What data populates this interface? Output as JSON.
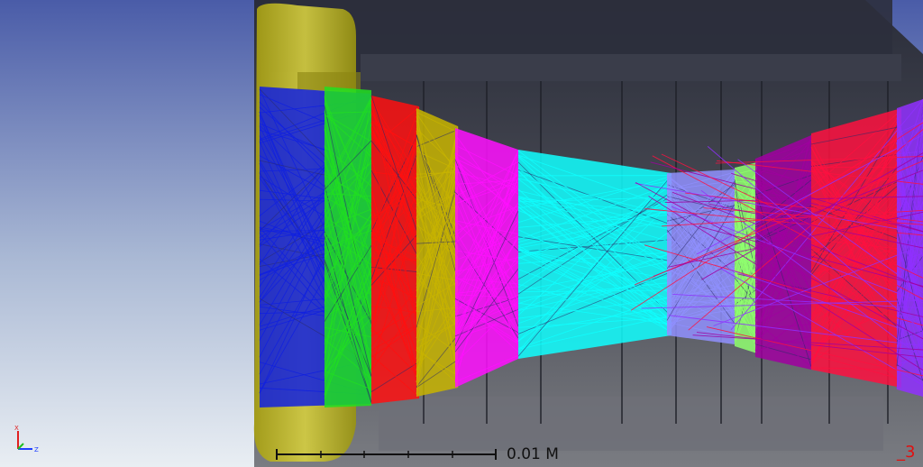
{
  "viewer": {
    "scale_bar": {
      "label": "0.01 M"
    },
    "corner_label": "_3",
    "axis_triad": {
      "x_label": "X",
      "y_label": "Y",
      "z_label": "Z",
      "colors": {
        "x": "#e02020",
        "y": "#20c020",
        "z": "#2040ff"
      }
    }
  },
  "colors": {
    "background_top": "#4a5ca8",
    "background_bottom": "#e8eef4",
    "housing": "#3a3d48",
    "housing_dark": "#2c2f3a",
    "mount_yellow": "#c8c020",
    "ray_groups": [
      "#1020e0",
      "#20e020",
      "#ff1010",
      "#c8b400",
      "#ff10ff",
      "#10ffff",
      "#9090ff",
      "#90ff70",
      "#a000a0",
      "#ff1040",
      "#9030ff"
    ]
  }
}
